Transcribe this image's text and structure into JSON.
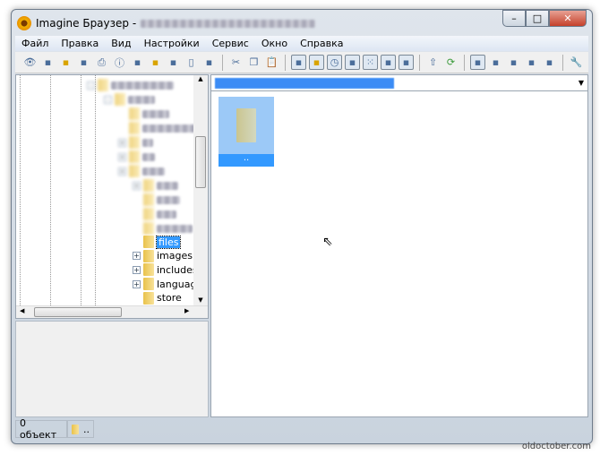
{
  "window": {
    "title": "Imagine Браузер -",
    "title_path_blurred": true
  },
  "menu": [
    "Файл",
    "Правка",
    "Вид",
    "Настройки",
    "Сервис",
    "Окно",
    "Справка"
  ],
  "toolbar": {
    "icons": [
      "view-icon",
      "slideshow-icon",
      "open-folder-icon",
      "copy-to-icon",
      "print-icon",
      "info-icon",
      "exif-icon",
      "new-folder-icon",
      "rename-icon",
      "delete-icon",
      "properties-icon",
      "cut-icon",
      "copy-icon",
      "paste-icon",
      "window-view-icon",
      "tree-icon",
      "history-icon",
      "thumbs-icon",
      "grid-icon",
      "preview-icon",
      "image-icon",
      "go-up-icon",
      "refresh-icon",
      "thumbnails-view-icon",
      "large-icons-view-icon",
      "icons-view-icon",
      "list-view-icon",
      "details-view-icon",
      "settings-icon"
    ]
  },
  "tree": {
    "visible_items": [
      {
        "label": "files",
        "selected": true,
        "expander": false
      },
      {
        "label": "images",
        "expander": true
      },
      {
        "label": "includes",
        "expander": true
      },
      {
        "label": "languag",
        "expander": true
      },
      {
        "label": "store",
        "expander": false
      }
    ]
  },
  "content": {
    "tile_label": ".."
  },
  "status": {
    "count": "0 объект",
    "folder": ".."
  },
  "watermark": "oldoctober.com"
}
